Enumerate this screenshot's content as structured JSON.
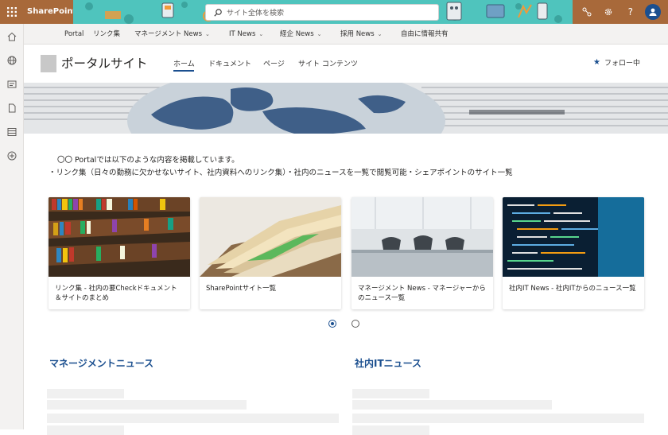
{
  "suite": {
    "brand": "SharePoint",
    "search_placeholder": "サイト全体を検索"
  },
  "hubnav": {
    "items": [
      {
        "label": "Portal",
        "has_menu": false
      },
      {
        "label": "リンク集",
        "has_menu": false
      },
      {
        "label": "マネージメント News",
        "has_menu": true
      },
      {
        "label": "IT News",
        "has_menu": true
      },
      {
        "label": "経企 News",
        "has_menu": true
      },
      {
        "label": "採用 News",
        "has_menu": true
      },
      {
        "label": "自由に情報共有",
        "has_menu": false
      }
    ]
  },
  "site": {
    "title": "ポータルサイト",
    "nav": [
      {
        "label": "ホーム",
        "active": true
      },
      {
        "label": "ドキュメント",
        "active": false
      },
      {
        "label": "ページ",
        "active": false
      },
      {
        "label": "サイト コンテンツ",
        "active": false
      }
    ],
    "follow_label": "フォロー中"
  },
  "intro": {
    "line1": "〇〇 Portalでは以下のような内容を掲載しています。",
    "line2": "・リンク集（日々の勤務に欠かせないサイト、社内資料へのリンク集）・社内のニュースを一覧で閲覧可能・シェアポイントのサイト一覧"
  },
  "cards": [
    {
      "caption": "リンク集 - 社内の要Checkドキュメント＆サイトのまとめ",
      "image": "bookshelf"
    },
    {
      "caption": "SharePointサイト一覧",
      "image": "file-folders"
    },
    {
      "caption": "マネージメント News - マネージャーからのニュース一覧",
      "image": "meeting-room"
    },
    {
      "caption": "社内IT News - 社内ITからのニュース一覧",
      "image": "code-screen"
    }
  ],
  "carousel": {
    "pages": 2,
    "current": 1
  },
  "news": {
    "left_heading": "マネージメントニュース",
    "right_heading": "社内ITニュース"
  },
  "colors": {
    "suite_brand": "#a8693a",
    "accent": "#1b4f8f",
    "banner": "#4fc4bd"
  }
}
